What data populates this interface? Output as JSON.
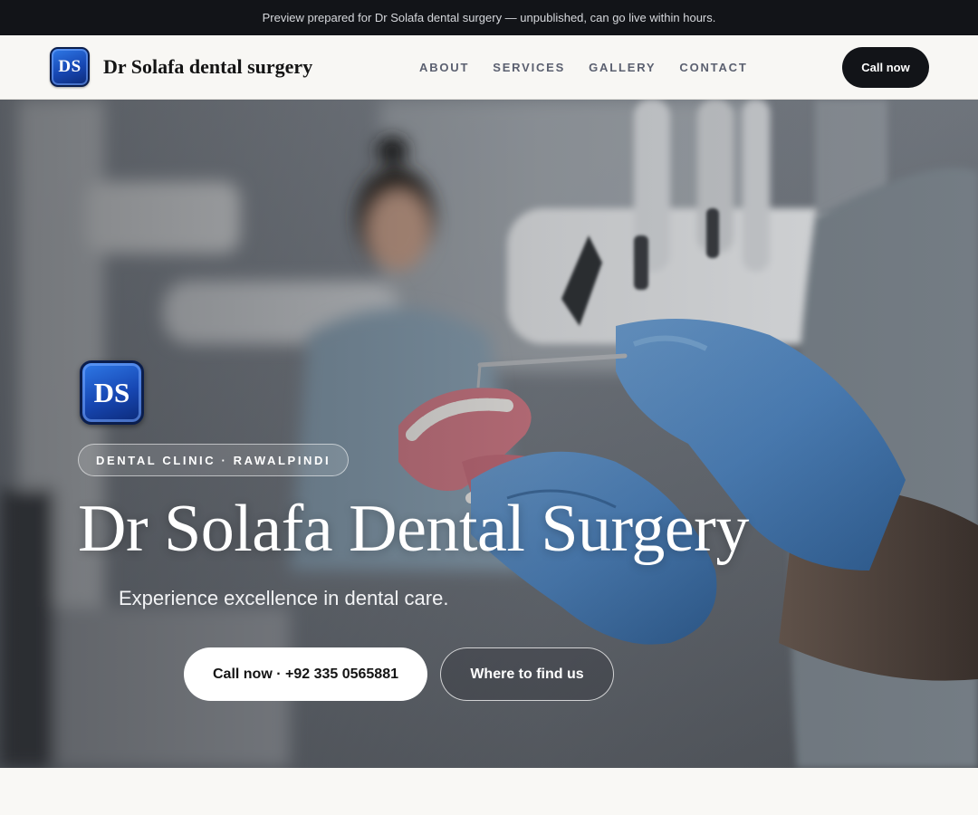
{
  "preview_banner": {
    "text": "Preview prepared for Dr Solafa dental surgery — unpublished, can go live within hours."
  },
  "header": {
    "logo_text": "DS",
    "brand_name": "Dr Solafa dental surgery",
    "nav": [
      {
        "label": "ABOUT"
      },
      {
        "label": "SERVICES"
      },
      {
        "label": "GALLERY"
      },
      {
        "label": "CONTACT"
      }
    ],
    "cta_label": "Call now"
  },
  "hero": {
    "logo_text": "DS",
    "tag": "DENTAL CLINIC · RAWALPINDI",
    "title": "Dr Solafa Dental Surgery",
    "subtitle": "Experience excellence in dental care.",
    "primary_button": "Call now · +92 335 0565881",
    "secondary_button": "Where to find us",
    "background_image": "dentist-holding-dental-model-photo"
  },
  "colors": {
    "banner_bg": "#121418",
    "header_bg": "#f8f7f4",
    "cta_bg": "#121418",
    "logo_blue": "#1747b3",
    "glove_blue": "#4f86c2",
    "hero_text": "#ffffff"
  }
}
